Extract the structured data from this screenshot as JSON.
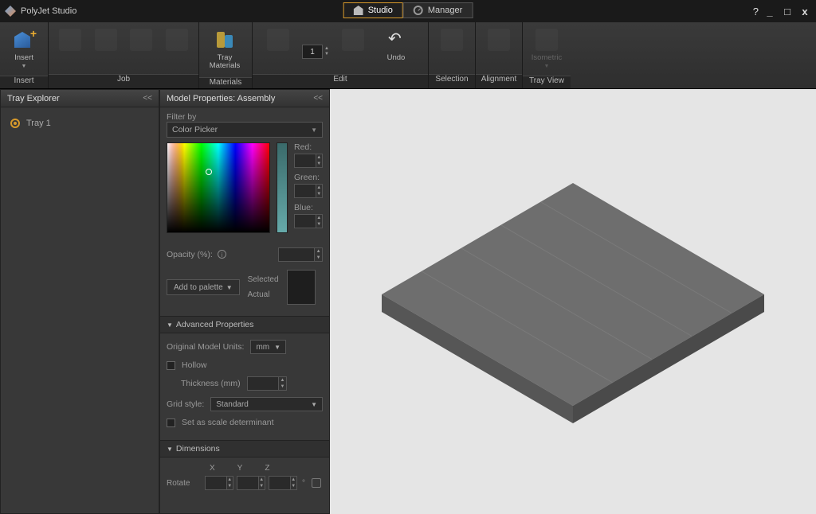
{
  "app": {
    "title": "PolyJet Studio"
  },
  "modes": {
    "studio": "Studio",
    "manager": "Manager"
  },
  "window": {
    "help": "?",
    "min": "_",
    "max": "□",
    "close": "x"
  },
  "ribbon": {
    "insert": {
      "label": "Insert",
      "btn_insert": "Insert"
    },
    "job": {
      "label": "Job"
    },
    "materials": {
      "label": "Materials",
      "tray_materials": "Tray Materials"
    },
    "edit": {
      "label": "Edit",
      "undo": "Undo",
      "qty": "1"
    },
    "selection": {
      "label": "Selection"
    },
    "alignment": {
      "label": "Alignment"
    },
    "trayview": {
      "label": "Tray View",
      "isometric": "Isometric"
    }
  },
  "tray_explorer": {
    "title": "Tray Explorer",
    "items": [
      "Tray 1"
    ]
  },
  "model_props": {
    "title": "Model Properties: Assembly",
    "filter_by": "Filter by",
    "filter_value": "Color Picker",
    "red": "Red:",
    "green": "Green:",
    "blue": "Blue:",
    "opacity_label": "Opacity (%):",
    "add_to_palette": "Add to palette",
    "selected": "Selected",
    "actual": "Actual",
    "adv_props": "Advanced Properties",
    "orig_units_label": "Original Model Units:",
    "orig_units_value": "mm",
    "hollow": "Hollow",
    "thickness": "Thickness (mm)",
    "grid_style_label": "Grid style:",
    "grid_style_value": "Standard",
    "scale_det": "Set as scale determinant",
    "dimensions": "Dimensions",
    "x": "X",
    "y": "Y",
    "z": "Z",
    "rotate": "Rotate"
  }
}
